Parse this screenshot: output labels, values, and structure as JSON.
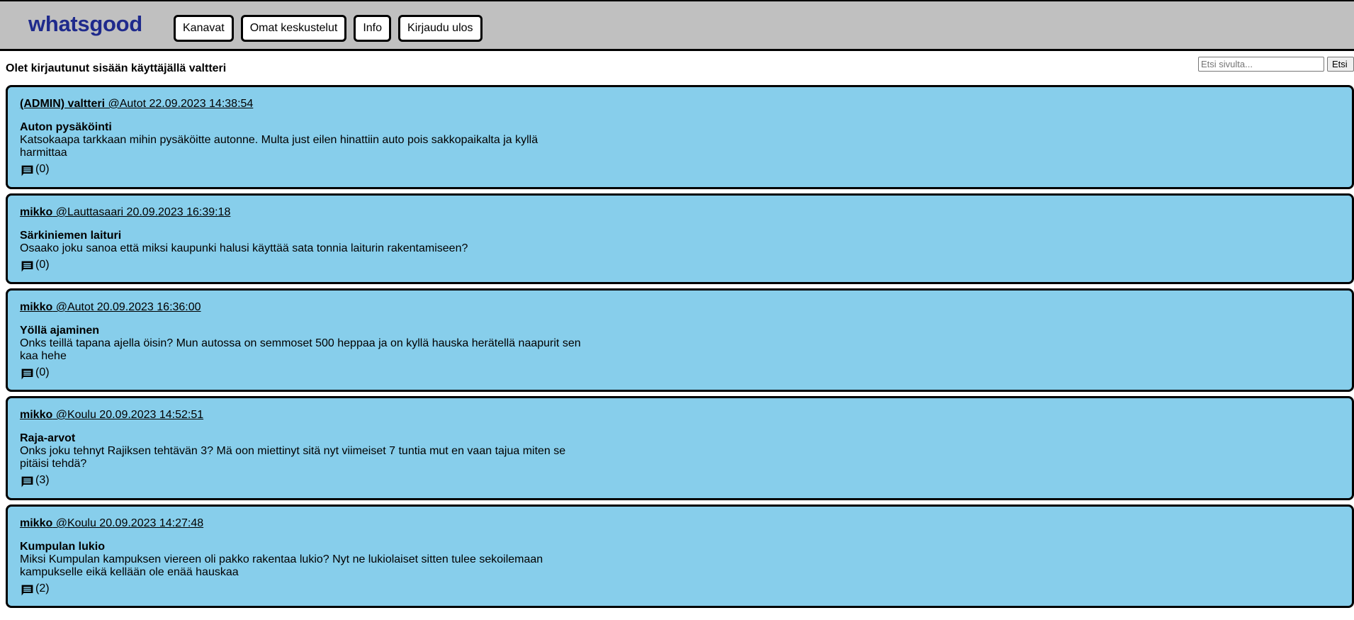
{
  "app": {
    "logo": "whatsgood"
  },
  "nav": {
    "items": [
      {
        "label": "Kanavat"
      },
      {
        "label": "Omat keskustelut"
      },
      {
        "label": "Info"
      },
      {
        "label": "Kirjaudu ulos"
      }
    ]
  },
  "status": {
    "login_text": "Olet kirjautunut sisään käyttäjällä valtteri"
  },
  "search": {
    "placeholder": "Etsi sivulta...",
    "value": "",
    "button_label": "Etsi"
  },
  "icons": {
    "comment": "comment-icon"
  },
  "colors": {
    "header_bg": "#c0c0c0",
    "logo": "#1f2a8c",
    "post_bg": "#87ceeb"
  },
  "posts": [
    {
      "author": "(ADMIN) valtteri",
      "meta": " @Autot 22.09.2023 14:38:54",
      "title": "Auton pysäköinti",
      "body": "Katsokaapa tarkkaan mihin pysäköitte autonne. Multa just eilen hinattiin auto pois sakkopaikalta ja kyllä harmittaa",
      "comments": "(0)"
    },
    {
      "author": "mikko",
      "meta": " @Lauttasaari 20.09.2023 16:39:18",
      "title": "Särkiniemen laituri",
      "body": "Osaako joku sanoa että miksi kaupunki halusi käyttää sata tonnia laiturin rakentamiseen?",
      "comments": "(0)"
    },
    {
      "author": "mikko",
      "meta": " @Autot 20.09.2023 16:36:00",
      "title": "Yöllä ajaminen",
      "body": "Onks teillä tapana ajella öisin? Mun autossa on semmoset 500 heppaa ja on kyllä hauska herätellä naapurit sen kaa hehe",
      "comments": "(0)"
    },
    {
      "author": "mikko",
      "meta": " @Koulu 20.09.2023 14:52:51",
      "title": "Raja-arvot",
      "body": "Onks joku tehnyt Rajiksen tehtävän 3? Mä oon miettinyt sitä nyt viimeiset 7 tuntia mut en vaan tajua miten se pitäisi tehdä?",
      "comments": "(3)"
    },
    {
      "author": "mikko",
      "meta": " @Koulu 20.09.2023 14:27:48",
      "title": "Kumpulan lukio",
      "body": "Miksi Kumpulan kampuksen viereen oli pakko rakentaa lukio? Nyt ne lukiolaiset sitten tulee sekoilemaan kampukselle eikä kellään ole enää hauskaa",
      "comments": "(2)"
    }
  ]
}
